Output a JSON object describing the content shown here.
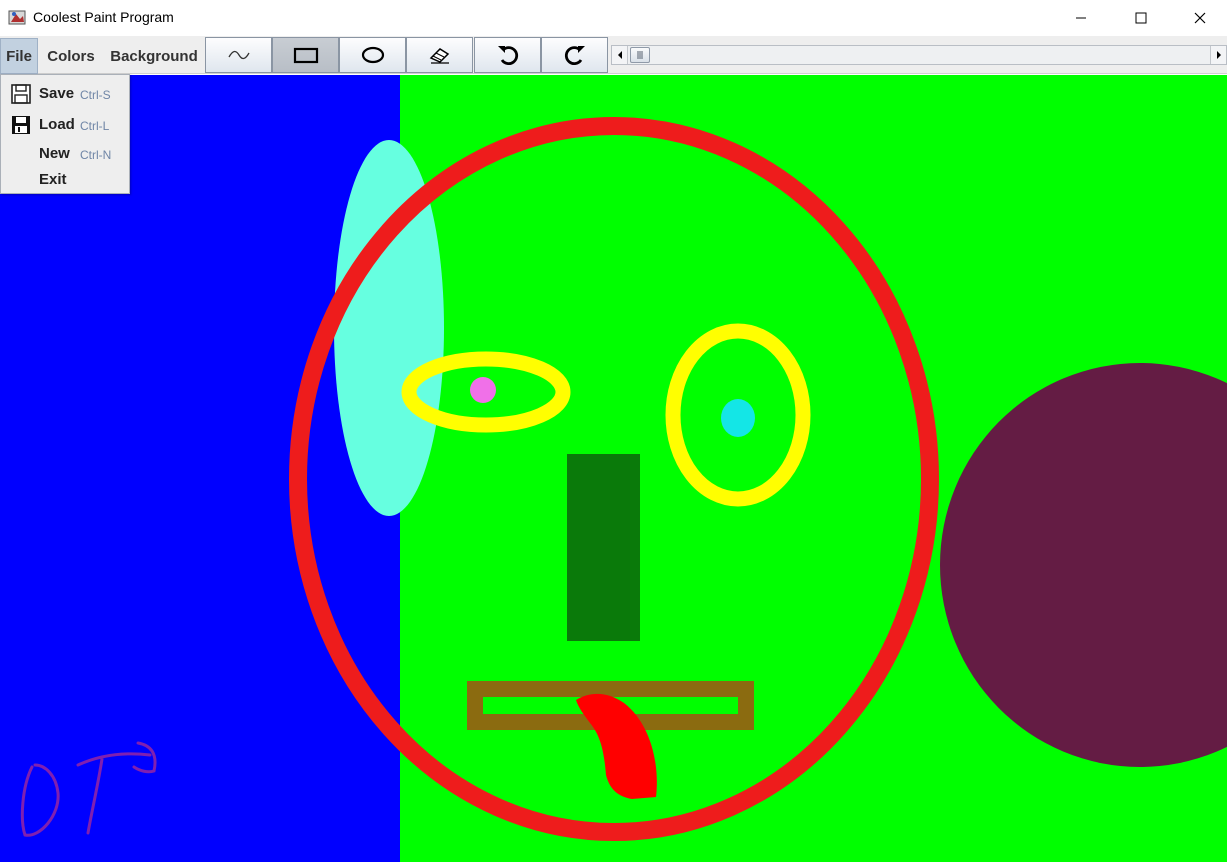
{
  "window": {
    "title": "Coolest Paint Program",
    "icon": "paint-app-icon",
    "controls": [
      "minimize-icon",
      "maximize-icon",
      "close-icon"
    ]
  },
  "menubar": {
    "file": "File",
    "colors": "Colors",
    "background": "Background"
  },
  "toolbar": {
    "tools": [
      {
        "icon": "freehand-icon",
        "active": false
      },
      {
        "icon": "rectangle-icon",
        "active": true
      },
      {
        "icon": "ellipse-icon",
        "active": false
      },
      {
        "icon": "eraser-icon",
        "active": false
      },
      {
        "icon": "undo-icon",
        "active": false
      },
      {
        "icon": "redo-icon",
        "active": false
      }
    ],
    "slider": {
      "value_fraction": 0.02
    }
  },
  "file_menu": {
    "items": [
      {
        "label": "Save",
        "accelerator": "Ctrl-S",
        "icon": "floppy-save-icon"
      },
      {
        "label": "Load",
        "accelerator": "Ctrl-L",
        "icon": "floppy-load-icon"
      },
      {
        "label": "New",
        "accelerator": "Ctrl-N",
        "icon": ""
      },
      {
        "label": "Exit",
        "accelerator": "",
        "icon": ""
      }
    ]
  },
  "canvas": {
    "colors": {
      "left_background": "#0000ff",
      "right_background": "#00ff00",
      "face_outline": "#ee1c1c",
      "eyes": "#ffff00",
      "nose": "#0a7a0a",
      "mouth": "#8b6b10",
      "tongue": "#ff0000",
      "cyan_ellipse": "#66ffe0",
      "maroon_ellipse": "#641c44",
      "pupil_left": "#f070e8",
      "pupil_right": "#14e6e6",
      "signature": "#8020b0"
    }
  }
}
